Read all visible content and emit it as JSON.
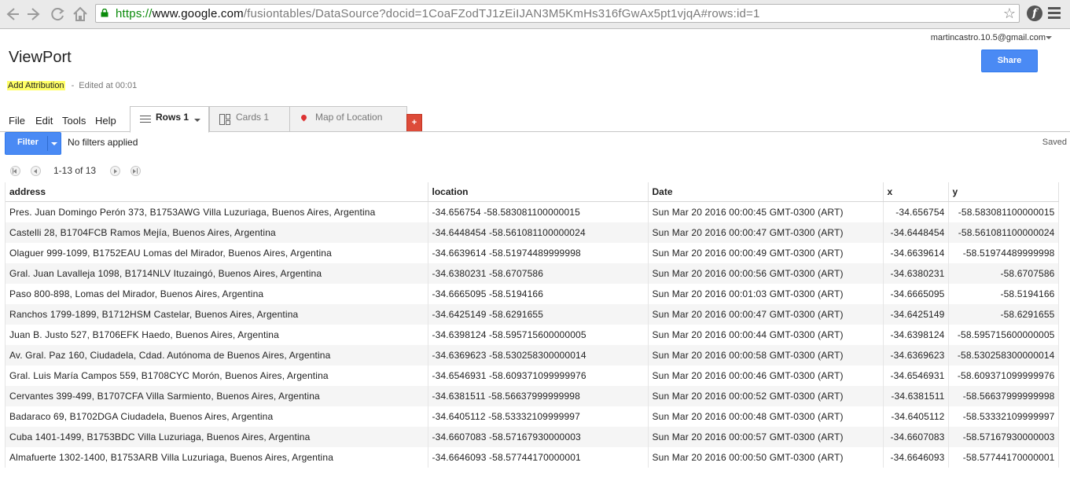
{
  "browser": {
    "url_proto": "https://",
    "url_host": "www.google.com",
    "url_path": "/fusiontables/DataSource?docid=1CoaFZodTJ1zEiIJAN3M5KmHs316fGwAx5pt1vjqA#rows:id=1"
  },
  "header": {
    "account": "martincastro.10.5@gmail.com",
    "share_label": "Share",
    "title": "ViewPort",
    "add_attribution": "Add Attribution",
    "separator": "-",
    "edited": "Edited at 00:01"
  },
  "menus": [
    "File",
    "Edit",
    "Tools",
    "Help"
  ],
  "tabs": {
    "rows": "Rows 1",
    "cards": "Cards 1",
    "map": "Map of Location",
    "add": "+"
  },
  "filter": {
    "label": "Filter",
    "status": "No filters applied",
    "saved": "Saved"
  },
  "pagination": {
    "range": "1-13 of 13"
  },
  "table": {
    "columns": [
      "address",
      "location",
      "Date",
      "x",
      "y"
    ],
    "rows": [
      [
        "Pres. Juan Domingo Perón 373, B1753AWG Villa Luzuriaga, Buenos Aires, Argentina",
        "-34.656754 -58.583081100000015",
        "Sun Mar 20 2016 00:00:45 GMT-0300 (ART)",
        "-34.656754",
        "-58.583081100000015"
      ],
      [
        "Castelli 28, B1704FCB Ramos Mejía, Buenos Aires, Argentina",
        "-34.6448454 -58.561081100000024",
        "Sun Mar 20 2016 00:00:47 GMT-0300 (ART)",
        "-34.6448454",
        "-58.561081100000024"
      ],
      [
        "Olaguer 999-1099, B1752EAU Lomas del Mirador, Buenos Aires, Argentina",
        "-34.6639614 -58.51974489999998",
        "Sun Mar 20 2016 00:00:49 GMT-0300 (ART)",
        "-34.6639614",
        "-58.51974489999998"
      ],
      [
        "Gral. Juan Lavalleja 1098, B1714NLV Ituzaingó, Buenos Aires, Argentina",
        "-34.6380231 -58.6707586",
        "Sun Mar 20 2016 00:00:56 GMT-0300 (ART)",
        "-34.6380231",
        "-58.6707586"
      ],
      [
        "Paso 800-898, Lomas del Mirador, Buenos Aires, Argentina",
        "-34.6665095 -58.5194166",
        "Sun Mar 20 2016 00:01:03 GMT-0300 (ART)",
        "-34.6665095",
        "-58.5194166"
      ],
      [
        "Ranchos 1799-1899, B1712HSM Castelar, Buenos Aires, Argentina",
        "-34.6425149 -58.6291655",
        "Sun Mar 20 2016 00:00:47 GMT-0300 (ART)",
        "-34.6425149",
        "-58.6291655"
      ],
      [
        "Juan B. Justo 527, B1706EFK Haedo, Buenos Aires, Argentina",
        "-34.6398124 -58.595715600000005",
        "Sun Mar 20 2016 00:00:44 GMT-0300 (ART)",
        "-34.6398124",
        "-58.595715600000005"
      ],
      [
        "Av. Gral. Paz 160, Ciudadela, Cdad. Autónoma de Buenos Aires, Argentina",
        "-34.6369623 -58.530258300000014",
        "Sun Mar 20 2016 00:00:58 GMT-0300 (ART)",
        "-34.6369623",
        "-58.530258300000014"
      ],
      [
        "Gral. Luis María Campos 559, B1708CYC Morón, Buenos Aires, Argentina",
        "-34.6546931 -58.609371099999976",
        "Sun Mar 20 2016 00:00:46 GMT-0300 (ART)",
        "-34.6546931",
        "-58.609371099999976"
      ],
      [
        "Cervantes 399-499, B1707CFA Villa Sarmiento, Buenos Aires, Argentina",
        "-34.6381511 -58.56637999999998",
        "Sun Mar 20 2016 00:00:52 GMT-0300 (ART)",
        "-34.6381511",
        "-58.56637999999998"
      ],
      [
        "Badaraco 69, B1702DGA Ciudadela, Buenos Aires, Argentina",
        "-34.6405112 -58.53332109999997",
        "Sun Mar 20 2016 00:00:48 GMT-0300 (ART)",
        "-34.6405112",
        "-58.53332109999997"
      ],
      [
        "Cuba 1401-1499, B1753BDC Villa Luzuriaga, Buenos Aires, Argentina",
        "-34.6607083 -58.57167930000003",
        "Sun Mar 20 2016 00:00:57 GMT-0300 (ART)",
        "-34.6607083",
        "-58.57167930000003"
      ],
      [
        "Almafuerte 1302-1400, B1753ARB Villa Luzuriaga, Buenos Aires, Argentina",
        "-34.6646093 -58.57744170000001",
        "Sun Mar 20 2016 00:00:50 GMT-0300 (ART)",
        "-34.6646093",
        "-58.57744170000001"
      ]
    ]
  },
  "colors": {
    "accent_blue": "#4a8af4",
    "add_tab_red": "#dd4b39",
    "highlight_yellow": "#ffff66"
  }
}
